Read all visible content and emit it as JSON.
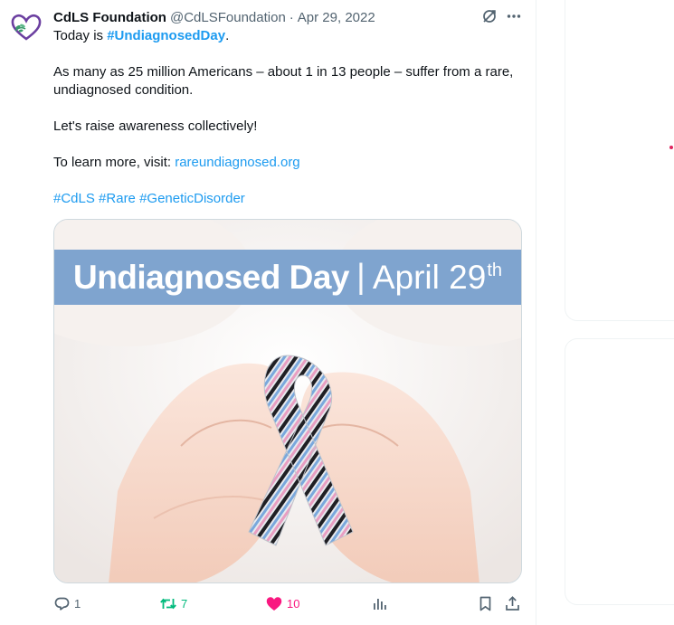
{
  "tweet": {
    "display_name": "CdLS Foundation",
    "handle": "@CdLSFoundation",
    "separator": "·",
    "date": "Apr 29, 2022",
    "line1_prefix": "Today is ",
    "line1_hashtag": "#UndiagnosedDay",
    "line1_suffix": ".",
    "para2_line1": "As many as 25 million Americans – about 1 in 13 people – suffer from a rare,",
    "para2_line2": "undiagnosed condition.",
    "para3": "Let's raise awareness collectively!",
    "para4_prefix": "To learn more, visit: ",
    "para4_link": "rareundiagnosed.org",
    "hashtags": [
      "#CdLS",
      "#Rare",
      "#GeneticDisorder"
    ],
    "media": {
      "banner_title": "Undiagnosed Day",
      "banner_separator": "|",
      "banner_date": "April 29",
      "banner_sup": "th"
    }
  },
  "actions": {
    "reply_count": "1",
    "retweet_count": "7",
    "like_count": "10"
  },
  "icons": {
    "avatar": "purple-heart-logo",
    "grok": "grok-icon",
    "more": "more-icon",
    "reply": "reply-icon",
    "retweet": "retweet-icon",
    "like": "heart-icon",
    "views": "views-icon",
    "bookmark": "bookmark-icon",
    "share": "share-icon"
  },
  "colors": {
    "link": "#1d9bf0",
    "retweeted": "#00ba7c",
    "liked": "#f91880",
    "muted": "#536471",
    "banner": "#7fa4cf"
  }
}
